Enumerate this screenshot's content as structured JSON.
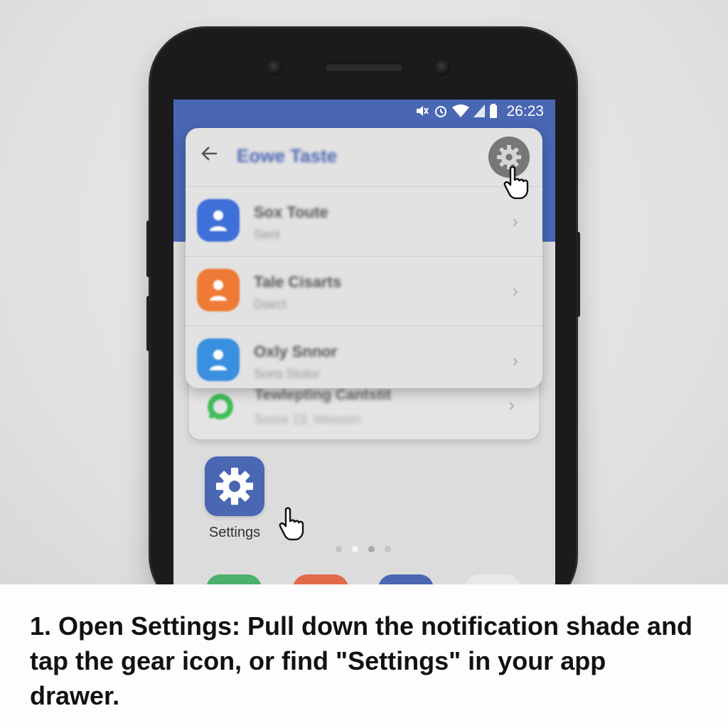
{
  "status_bar": {
    "time": "26:23",
    "icons": [
      "mute-icon",
      "alarm-icon",
      "wifi-icon",
      "signal-icon",
      "battery-icon"
    ]
  },
  "notification_panel": {
    "title": "Eowe Taste",
    "rows": [
      {
        "title": "Sox Toute",
        "subtitle": "Sent",
        "icon": "contact-icon",
        "color": "#3f6fd8"
      },
      {
        "title": "Tale Cisarts",
        "subtitle": "Dsect",
        "icon": "contact-icon",
        "color": "#ef7a35"
      },
      {
        "title": "Oxly Snnor",
        "subtitle": "Sons Stolor",
        "icon": "contact-icon",
        "color": "#3b8fe0"
      }
    ],
    "secondary_card": {
      "title": "Tewlepting Cantstit",
      "subtitle": "Soore 19, Weeonn"
    }
  },
  "home": {
    "settings_label": "Settings",
    "page_dots": 4,
    "active_dot": 1,
    "dock_colors": [
      "#4caf6a",
      "#e06a4a",
      "#4a67b4",
      "#e8e8e8"
    ]
  },
  "caption": {
    "text": "1. Open Settings: Pull down the notification shade and tap the gear icon, or find \"Settings\" in your app drawer."
  },
  "colors": {
    "accent": "#4a67b4",
    "phone_body": "#1b1b1b"
  }
}
